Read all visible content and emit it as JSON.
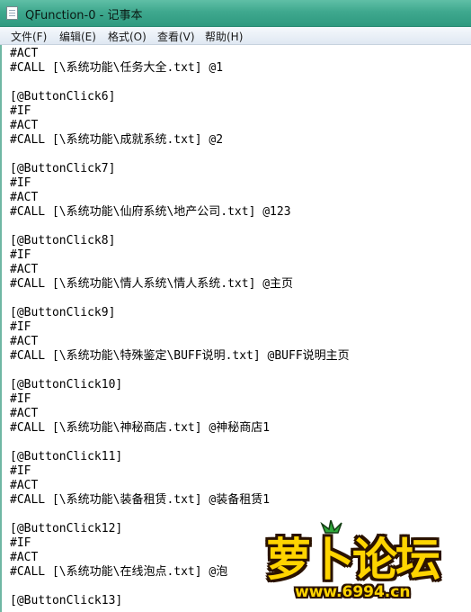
{
  "window": {
    "title": "QFunction-0 - 记事本",
    "icon": "notepad-icon"
  },
  "menu": {
    "items": [
      {
        "label": "文件(F)"
      },
      {
        "label": "编辑(E)"
      },
      {
        "label": "格式(O)"
      },
      {
        "label": "查看(V)"
      },
      {
        "label": "帮助(H)"
      }
    ]
  },
  "editor": {
    "lines": [
      "#ACT",
      "#CALL [\\系统功能\\任务大全.txt] @1",
      "",
      "[@ButtonClick6]",
      "#IF",
      "#ACT",
      "#CALL [\\系统功能\\成就系统.txt] @2",
      "",
      "[@ButtonClick7]",
      "#IF",
      "#ACT",
      "#CALL [\\系统功能\\仙府系统\\地产公司.txt] @123",
      "",
      "[@ButtonClick8]",
      "#IF",
      "#ACT",
      "#CALL [\\系统功能\\情人系统\\情人系统.txt] @主页",
      "",
      "[@ButtonClick9]",
      "#IF",
      "#ACT",
      "#CALL [\\系统功能\\特殊鉴定\\BUFF说明.txt] @BUFF说明主页",
      "",
      "[@ButtonClick10]",
      "#IF",
      "#ACT",
      "#CALL [\\系统功能\\神秘商店.txt] @神秘商店1",
      "",
      "[@ButtonClick11]",
      "#IF",
      "#ACT",
      "#CALL [\\系统功能\\装备租赁.txt] @装备租赁1",
      "",
      "[@ButtonClick12]",
      "#IF",
      "#ACT",
      "#CALL [\\系统功能\\在线泡点.txt] @泡",
      "",
      "[@ButtonClick13]"
    ]
  },
  "watermark": {
    "title": "萝卜论坛",
    "url": "www.6994.cn"
  }
}
